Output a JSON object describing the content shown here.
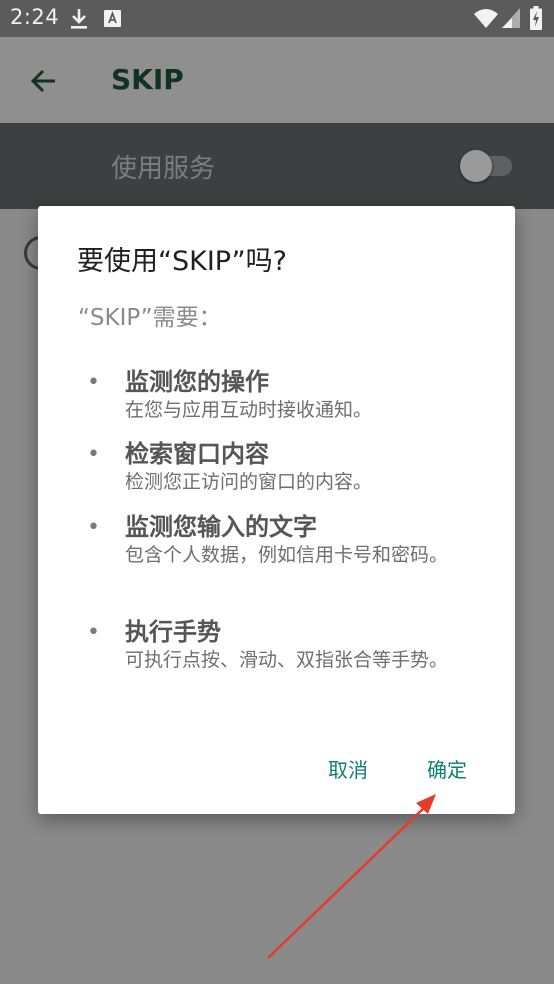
{
  "status_bar": {
    "time": "2:24",
    "icons": [
      "download-icon",
      "a-notification-icon",
      "wifi-icon",
      "cell-signal-icon",
      "battery-charging-icon"
    ]
  },
  "app_bar": {
    "title": "SKIP",
    "back_icon": "arrow-left-icon"
  },
  "service_row": {
    "label": "使用服务",
    "switch_on": false
  },
  "dialog": {
    "title": "要使用“SKIP”吗?",
    "subtitle": "“SKIP”需要：",
    "permissions": [
      {
        "title": "监测您的操作",
        "description": "在您与应用互动时接收通知。"
      },
      {
        "title": "检索窗口内容",
        "description": "检测您正访问的窗口的内容。"
      },
      {
        "title": "监测您输入的文字",
        "description": "包含个人数据，例如信用卡号和密码。"
      },
      {
        "title": "执行手势",
        "description": "可执行点按、滑动、双指张合等手势。"
      }
    ],
    "cancel_label": "取消",
    "ok_label": "确定"
  },
  "colors": {
    "accent": "#0d7f73",
    "annotation_arrow": "#e8392b"
  }
}
